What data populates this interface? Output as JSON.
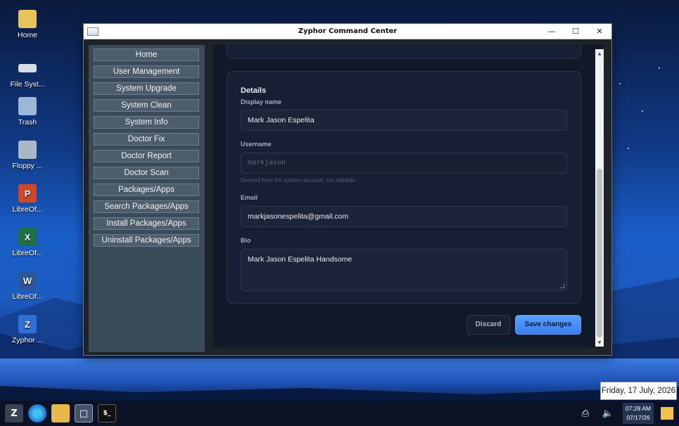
{
  "desktop": {
    "icons": [
      {
        "label": "Home",
        "icon": "home-folder-icon"
      },
      {
        "label": "File Syst...",
        "icon": "drive-icon"
      },
      {
        "label": "Trash",
        "icon": "trash-icon"
      },
      {
        "label": "Floppy ...",
        "icon": "floppy-icon"
      },
      {
        "label": "LibreOf...",
        "icon": "presentation-icon",
        "glyph": "P"
      },
      {
        "label": "LibreOf...",
        "icon": "spreadsheet-icon",
        "glyph": "X"
      },
      {
        "label": "LibreOf...",
        "icon": "document-icon",
        "glyph": "W"
      },
      {
        "label": "Zyphor ...",
        "icon": "zyphor-icon",
        "glyph": "Z"
      }
    ]
  },
  "window": {
    "title": "Zyphor Command Center",
    "controls": {
      "minimize": "—",
      "maximize": "☐",
      "close": "✕"
    }
  },
  "sidebar": {
    "items": [
      {
        "label": "Home"
      },
      {
        "label": "User Management"
      },
      {
        "label": "System Upgrade"
      },
      {
        "label": "System Clean"
      },
      {
        "label": "System Info"
      },
      {
        "label": "Doctor Fix"
      },
      {
        "label": "Doctor Report"
      },
      {
        "label": "Doctor Scan"
      },
      {
        "label": "Packages/Apps"
      },
      {
        "label": "Search Packages/Apps"
      },
      {
        "label": "Install Packages/Apps"
      },
      {
        "label": "Uninstall Packages/Apps"
      }
    ]
  },
  "details": {
    "title": "Details",
    "display_name_label": "Display name",
    "display_name_value": "Mark Jason Espelita",
    "username_label": "Username",
    "username_value": "markjason",
    "username_hint": "Derived from the system account, not editable.",
    "email_label": "Email",
    "email_value": "markjasonespelita@gmail.com",
    "bio_label": "Bio",
    "bio_value": "Mark Jason Espelita Handsome",
    "discard_label": "Discard",
    "save_label": "Save changes"
  },
  "taskbar": {
    "clock_time": "07:28 AM",
    "clock_date": "07/17/26",
    "date_tooltip": "Friday, 17 July, 2026"
  },
  "colors": {
    "accent": "#3a7cf0",
    "sidebar": "#3b4a57",
    "content_bg": "#111827",
    "card_bg": "#161f33"
  }
}
